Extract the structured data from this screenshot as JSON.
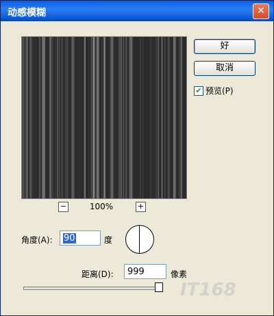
{
  "window": {
    "title": "动感模糊",
    "close_symbol": "✕"
  },
  "buttons": {
    "ok": "好",
    "cancel": "取消"
  },
  "preview_option": {
    "label": "预览(P)",
    "checked": true,
    "check_mark": "✔"
  },
  "zoom": {
    "minus": "−",
    "level": "100%",
    "plus": "+"
  },
  "angle": {
    "label": "角度(A):",
    "value": "90",
    "unit": "度"
  },
  "distance": {
    "label": "距离(D):",
    "value": "999",
    "unit": "像素",
    "slider_fraction": 1
  },
  "watermark": "IT168",
  "colors": {
    "title_bar": "#0a5ce0",
    "dialog_bg": "#ece9d8",
    "preview_bg": "#2b2b2b"
  }
}
